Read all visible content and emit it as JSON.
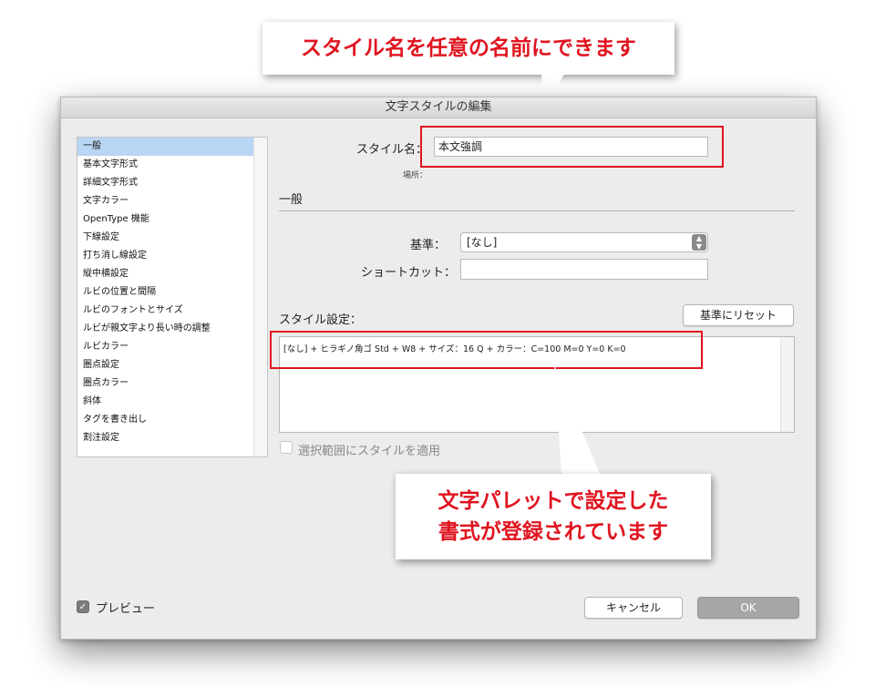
{
  "dialog": {
    "title": "文字スタイルの編集",
    "sidebar": {
      "items": [
        {
          "label": "一般",
          "selected": true
        },
        {
          "label": "基本文字形式",
          "selected": false
        },
        {
          "label": "詳細文字形式",
          "selected": false
        },
        {
          "label": "文字カラー",
          "selected": false
        },
        {
          "label": "OpenType 機能",
          "selected": false
        },
        {
          "label": "下線設定",
          "selected": false
        },
        {
          "label": "打ち消し線設定",
          "selected": false
        },
        {
          "label": "縦中横設定",
          "selected": false
        },
        {
          "label": "ルビの位置と間隔",
          "selected": false
        },
        {
          "label": "ルビのフォントとサイズ",
          "selected": false
        },
        {
          "label": "ルビが親文字より長い時の調整",
          "selected": false
        },
        {
          "label": "ルビカラー",
          "selected": false
        },
        {
          "label": "圏点設定",
          "selected": false
        },
        {
          "label": "圏点カラー",
          "selected": false
        },
        {
          "label": "斜体",
          "selected": false
        },
        {
          "label": "タグを書き出し",
          "selected": false
        },
        {
          "label": "割注設定",
          "selected": false
        }
      ]
    },
    "style_name_label": "スタイル名：",
    "style_name_value": "本文強調",
    "location_label": "場所：",
    "section_title": "一般",
    "based_on_label": "基準：",
    "based_on_value": "[なし]",
    "shortcut_label": "ショートカット：",
    "shortcut_value": "",
    "style_settings_label": "スタイル設定：",
    "reset_button": "基準にリセット",
    "style_settings_text": "[なし] + ヒラギノ角ゴ Std + W8 + サイズ：16 Q + カラー：C=100 M=0 Y=0 K=0",
    "apply_label": "選択範囲にスタイルを適用",
    "apply_checked": false,
    "preview_label": "プレビュー",
    "preview_checked": true,
    "cancel_button": "キャンセル",
    "ok_button": "OK"
  },
  "annotations": {
    "top_callout": "スタイル名を任意の名前にできます",
    "bottom_callout_line1": "文字パレットで設定した",
    "bottom_callout_line2": "書式が登録されています",
    "color": "#e0141f"
  }
}
